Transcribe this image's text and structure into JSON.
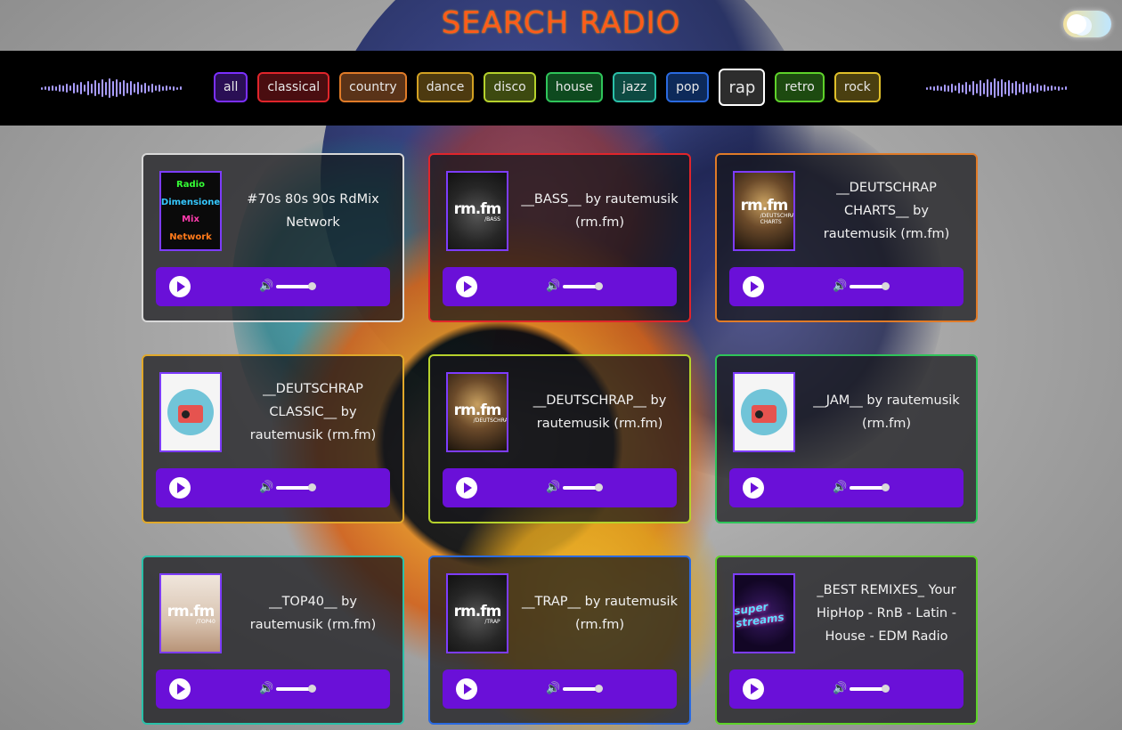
{
  "header": {
    "title": "SEARCH RADIO"
  },
  "genres": [
    {
      "label": "all",
      "color": "#7b2fff",
      "bg": "#2a0f55",
      "active": false
    },
    {
      "label": "classical",
      "color": "#e0252b",
      "bg": "#4a0d10",
      "active": false
    },
    {
      "label": "country",
      "color": "#e07b28",
      "bg": "#5a3318",
      "active": false
    },
    {
      "label": "dance",
      "color": "#d2a122",
      "bg": "#4d3a10",
      "active": false
    },
    {
      "label": "disco",
      "color": "#b5d12c",
      "bg": "#3d4a10",
      "active": false
    },
    {
      "label": "house",
      "color": "#2fc45a",
      "bg": "#0e4a1f",
      "active": false
    },
    {
      "label": "jazz",
      "color": "#2ac0a8",
      "bg": "#0d4a42",
      "active": false
    },
    {
      "label": "pop",
      "color": "#2a6ae0",
      "bg": "#0d2a5a",
      "active": false
    },
    {
      "label": "rap",
      "color": "#ffffff",
      "bg": "#2d2d2d",
      "active": true
    },
    {
      "label": "retro",
      "color": "#5ed22a",
      "bg": "#1d4a10",
      "active": false
    },
    {
      "label": "rock",
      "color": "#e0c02a",
      "bg": "#4a3f10",
      "active": false
    }
  ],
  "stations": [
    {
      "title": "#70s 80s 90s RdMix Network",
      "border": "#d8d8d8",
      "thumb": "radio-dimensione",
      "thumb_text": [
        "Radio",
        "Dimensione",
        "Mix",
        "Network"
      ]
    },
    {
      "title": "__BASS__ by rautemusik (rm.fm)",
      "border": "#e0252b",
      "thumb": "rmfm",
      "thumb_text": [
        "rm.fm",
        "/BASS"
      ]
    },
    {
      "title": "__DEUTSCHRAP CHARTS__ by rautemusik (rm.fm)",
      "border": "#e07b28",
      "thumb": "rmfm-brown",
      "thumb_text": [
        "rm.fm",
        "/DEUTSCHRAP CHARTS"
      ]
    },
    {
      "title": "__DEUTSCHRAP CLASSIC__ by rautemusik (rm.fm)",
      "border": "#e0a82a",
      "thumb": "boombox",
      "thumb_text": []
    },
    {
      "title": "__DEUTSCHRAP__ by rautemusik (rm.fm)",
      "border": "#b5d12c",
      "thumb": "rmfm-brown",
      "thumb_text": [
        "rm.fm",
        "/DEUTSCHRAP"
      ]
    },
    {
      "title": "__JAM__ by rautemusik (rm.fm)",
      "border": "#2fc45a",
      "thumb": "boombox",
      "thumb_text": []
    },
    {
      "title": "__TOP40__ by rautemusik (rm.fm)",
      "border": "#2ac0a8",
      "thumb": "rmfm-light",
      "thumb_text": [
        "rm.fm",
        "/TOP40"
      ]
    },
    {
      "title": "__TRAP__ by rautemusik (rm.fm)",
      "border": "#2a6ae0",
      "thumb": "rmfm",
      "thumb_text": [
        "rm.fm",
        "/TRAP"
      ]
    },
    {
      "title": "_BEST REMIXES_ Your HipHop - RnB - Latin - House - EDM Radio",
      "border": "#5ed22a",
      "thumb": "superstreams",
      "thumb_text": [
        "super streams"
      ]
    }
  ],
  "player": {
    "volume": 0.9,
    "play_icon": "play-icon",
    "volume_icon": "volume-icon"
  },
  "colors": {
    "title": "#ff5a1a",
    "player_bg": "#6a10d8",
    "thumb_border": "#7d3cff"
  }
}
